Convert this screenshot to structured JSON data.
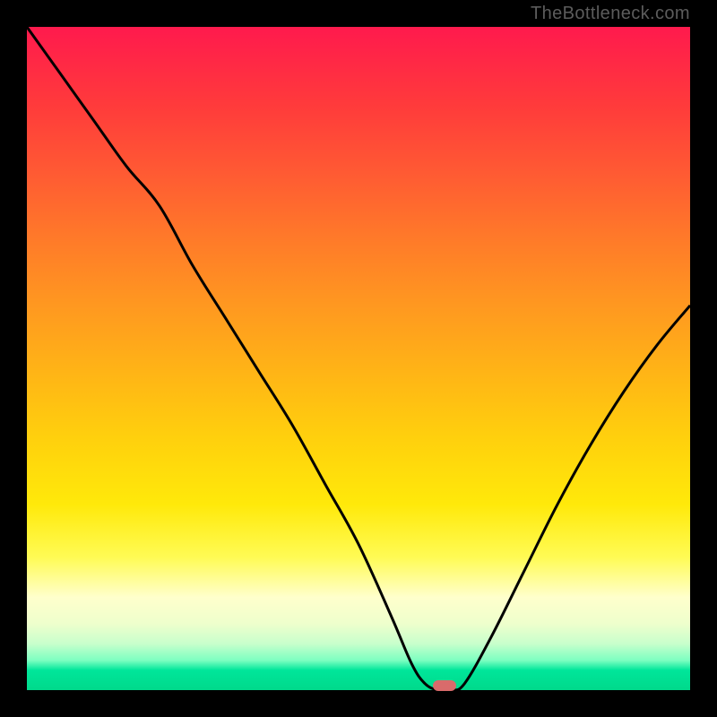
{
  "watermark_text": "TheBottleneck.com",
  "colors": {
    "line": "#000000",
    "marker": "#d96b6b"
  },
  "chart_data": {
    "type": "line",
    "title": "",
    "xlabel": "",
    "ylabel": "",
    "xlim": [
      0,
      100
    ],
    "ylim": [
      0,
      100
    ],
    "grid": false,
    "legend": false,
    "note": "axes unlabeled; values are relative percentages estimated from pixel positions; y is bottleneck-like metric where 0 is optimal",
    "series": [
      {
        "name": "curve",
        "x": [
          0,
          5,
          10,
          15,
          20,
          25,
          30,
          35,
          40,
          45,
          50,
          55,
          58,
          60,
          62,
          64,
          66,
          70,
          75,
          80,
          85,
          90,
          95,
          100
        ],
        "y": [
          100,
          93,
          86,
          79,
          73,
          64,
          56,
          48,
          40,
          31,
          22,
          11,
          4,
          1,
          0,
          0,
          1,
          8,
          18,
          28,
          37,
          45,
          52,
          58
        ]
      }
    ],
    "optimal_marker": {
      "x": 63,
      "y": 0.7
    }
  }
}
